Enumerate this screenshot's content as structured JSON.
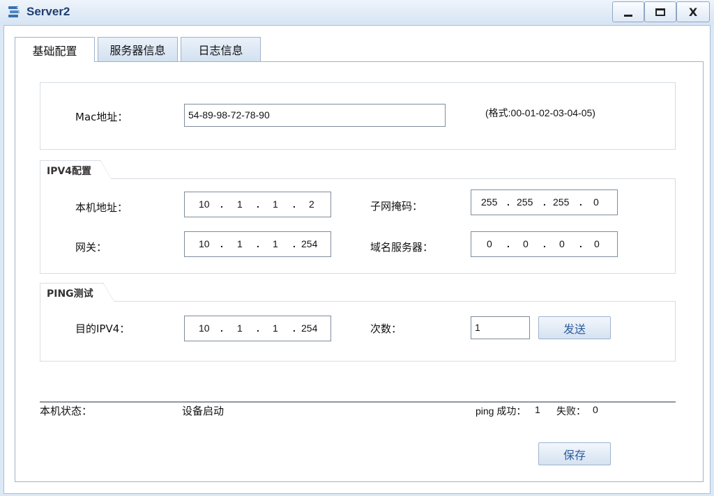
{
  "window": {
    "title": "Server2",
    "minimize_label": "_",
    "close_label": "X"
  },
  "tabs": [
    {
      "label": "基础配置",
      "active": true
    },
    {
      "label": "服务器信息",
      "active": false
    },
    {
      "label": "日志信息",
      "active": false
    }
  ],
  "mac": {
    "label": "Mac地址：",
    "value": "54-89-98-72-78-90",
    "format_hint": "(格式:00-01-02-03-04-05)"
  },
  "ipv4": {
    "legend": "IPV4配置",
    "local_ip_label": "本机地址：",
    "local_ip": [
      "10",
      "1",
      "1",
      "2"
    ],
    "subnet_label": "子网掩码：",
    "subnet": [
      "255",
      "255",
      "255",
      "0"
    ],
    "gateway_label": "网关：",
    "gateway": [
      "10",
      "1",
      "1",
      "254"
    ],
    "dns_label": "域名服务器：",
    "dns": [
      "0",
      "0",
      "0",
      "0"
    ]
  },
  "ping": {
    "legend": "PING测试",
    "target_label": "目的IPV4：",
    "target": [
      "10",
      "1",
      "1",
      "254"
    ],
    "count_label": "次数：",
    "count": "1",
    "send_button": "发送"
  },
  "status": {
    "label": "本机状态：",
    "value": "设备启动",
    "ping_success_label": "ping 成功：",
    "ping_success": "1",
    "ping_fail_label": "失败：",
    "ping_fail": "0"
  },
  "save_button": "保存",
  "colors": {
    "titlebar": "#d6e4f3",
    "title_text": "#1f3f6e",
    "button_text": "#2d5d9c",
    "border": "#9eb2cb"
  }
}
